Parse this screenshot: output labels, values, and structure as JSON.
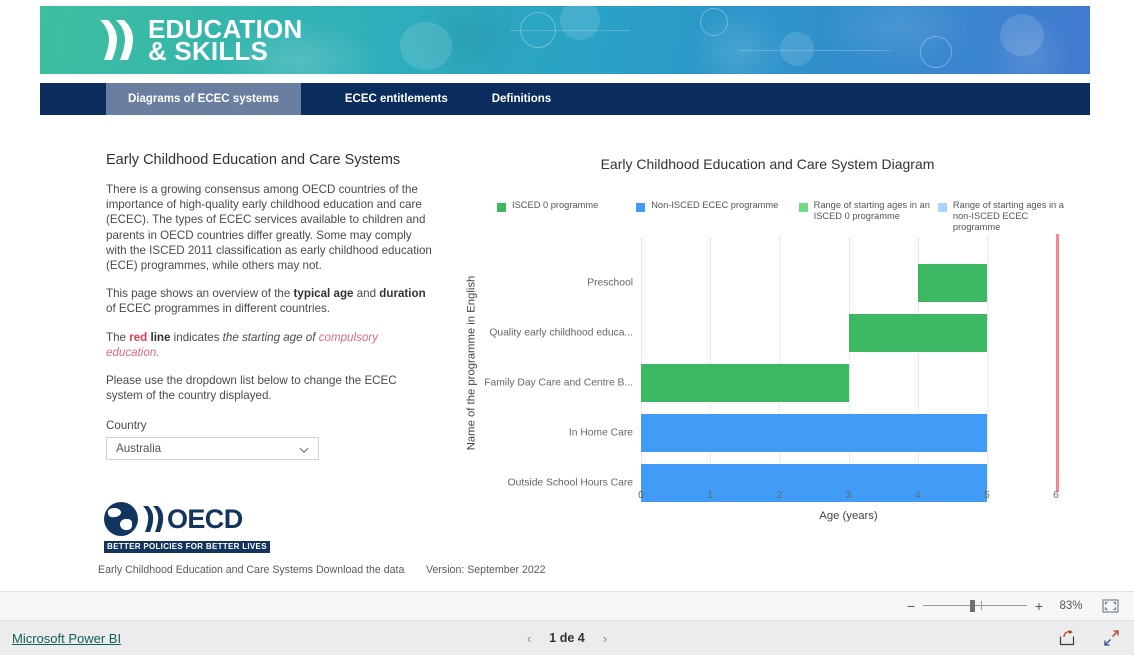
{
  "banner": {
    "brand_line1": "EDUCATION",
    "brand_line2": "& SKILLS",
    "chevron_icon": "double-chevron-icon"
  },
  "tabs": [
    {
      "label": "Diagrams of ECEC systems",
      "active": true
    },
    {
      "label": "ECEC entitlements",
      "active": false
    },
    {
      "label": "Definitions",
      "active": false
    }
  ],
  "left_panel": {
    "title": "Early Childhood Education and Care Systems",
    "paragraph1": "There is a growing consensus among OECD countries of the importance of high-quality early childhood education and care (ECEC).  The types of ECEC services available to children and parents in OECD countries differ greatly. Some may comply with the ISCED 2011 classification as early childhood education (ECE) programmes, while others may not.",
    "paragraph2_pre": "This page shows an overview of the ",
    "paragraph2_bold1": "typical age",
    "paragraph2_mid": " and ",
    "paragraph2_bold2": "duration",
    "paragraph2_post": " of ECEC programmes in different countries.",
    "paragraph3_pre": "The ",
    "paragraph3_red": "red",
    "paragraph3_bold": " line",
    "paragraph3_mid": " indicates ",
    "paragraph3_italic": "the starting age of ",
    "paragraph3_italic_red": "compulsory education.",
    "paragraph4": "Please use the dropdown list below to change the ECEC system of the country displayed.",
    "country_label": "Country",
    "country_value": "Australia",
    "dropdown_icon": "chevron-down-icon"
  },
  "logo": {
    "word": "OECD",
    "tagline": "BETTER POLICIES FOR BETTER LIVES",
    "globe_icon": "globe-icon",
    "chevron_icon": "double-chevron-icon"
  },
  "report_footer": {
    "link1": "Early Childhood Education and Care Systems",
    "link2": "Download the data",
    "version": "Version: September 2022"
  },
  "colors": {
    "green": "#3cb863",
    "blue": "#409cf7",
    "green_light": "#6fdc85",
    "blue_light": "#a8d5fb",
    "red_line": "#ef8893",
    "navy": "#0a2d5e",
    "tab_active": "#6a7fa0",
    "oecd_navy": "#12355f"
  },
  "chart_data": {
    "type": "bar",
    "title": "Early Childhood Education and Care System Diagram",
    "xlabel": "Age (years)",
    "ylabel": "Name of the programme in English",
    "xlim": [
      0,
      6
    ],
    "xticks": [
      0,
      1,
      2,
      3,
      4,
      5,
      6
    ],
    "grid": true,
    "orientation": "horizontal",
    "legend_position": "top",
    "legend": [
      {
        "label": "ISCED 0 programme",
        "color": "#3cb863"
      },
      {
        "label": "Non-ISCED ECEC programme",
        "color": "#409cf7"
      },
      {
        "label": "Range of starting ages in an ISCED 0 programme",
        "color": "#6fdc85"
      },
      {
        "label": "Range of starting ages in a non-ISCED ECEC programme",
        "color": "#a8d5fb"
      }
    ],
    "categories": [
      "Preschool",
      "Quality early childhood educa...",
      "Family Day Care and Centre B...",
      "In Home Care",
      "Outside School Hours Care"
    ],
    "bars": [
      {
        "category": "Preschool",
        "start": 4,
        "end": 5,
        "color": "#3cb863",
        "series": "ISCED 0 programme"
      },
      {
        "category": "Quality early childhood educa...",
        "start": 3,
        "end": 5,
        "color": "#3cb863",
        "series": "ISCED 0 programme"
      },
      {
        "category": "Family Day Care and Centre B...",
        "start": 0,
        "end": 3,
        "color": "#3cb863",
        "series": "ISCED 0 programme"
      },
      {
        "category": "In Home Care",
        "start": 0,
        "end": 5,
        "color": "#409cf7",
        "series": "Non-ISCED ECEC programme"
      },
      {
        "category": "Outside School Hours Care",
        "start": 0,
        "end": 5,
        "color": "#409cf7",
        "series": "Non-ISCED ECEC programme"
      }
    ],
    "reference_line": {
      "value": 6,
      "label": "compulsory education start age",
      "color": "#ef8893"
    }
  },
  "pbi_toolbar": {
    "zoom_out_label": "−",
    "zoom_in_label": "+",
    "zoom_percent": "83%",
    "fit_icon": "fit-to-page-icon"
  },
  "pbi_bottom": {
    "logo_text": "Microsoft Power BI",
    "prev_icon": "chevron-left-icon",
    "page_text": "1 de 4",
    "next_icon": "chevron-right-icon",
    "share_icon": "share-icon",
    "fullscreen_icon": "fullscreen-icon"
  }
}
